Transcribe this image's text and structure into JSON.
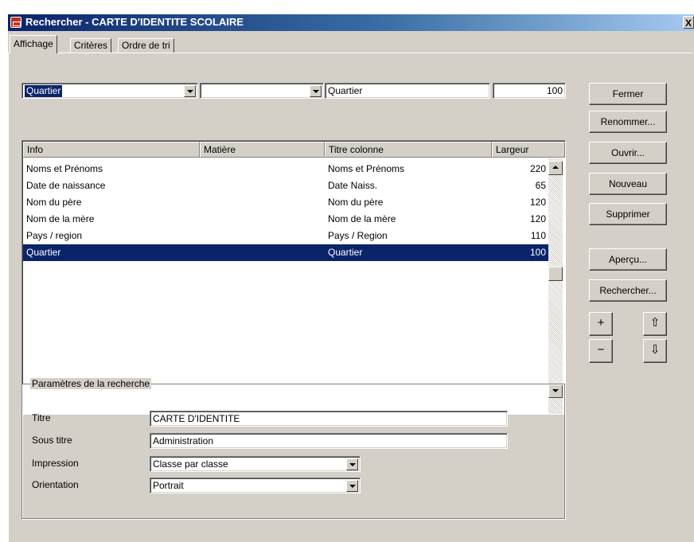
{
  "window": {
    "title": "Rechercher - CARTE D'IDENTITE SCOLAIRE",
    "close_label": "X"
  },
  "tabs": [
    {
      "label": "Affichage",
      "active": true
    },
    {
      "label": "Critères",
      "active": false
    },
    {
      "label": "Ordre de tri",
      "active": false
    }
  ],
  "editor": {
    "info_select": "Quartier",
    "matiere_select": "",
    "titre_colonne": "Quartier",
    "largeur": "100"
  },
  "grid": {
    "columns": [
      "Info",
      "Matière",
      "Titre colonne",
      "Largeur"
    ],
    "rows": [
      {
        "info": "Noms et Prénoms",
        "matiere": "",
        "titre": "Noms et Prénoms",
        "largeur": "220"
      },
      {
        "info": "Date de naissance",
        "matiere": "",
        "titre": "Date Naiss.",
        "largeur": "65"
      },
      {
        "info": "Nom du père",
        "matiere": "",
        "titre": "Nom du père",
        "largeur": "120"
      },
      {
        "info": "Nom de la mère",
        "matiere": "",
        "titre": "Nom de la mère",
        "largeur": "120"
      },
      {
        "info": "Pays / region",
        "matiere": "",
        "titre": "Pays / Region",
        "largeur": "110"
      },
      {
        "info": "Quartier",
        "matiere": "",
        "titre": "Quartier",
        "largeur": "100",
        "selected": true
      }
    ]
  },
  "buttons": {
    "fermer": "Fermer",
    "renommer": "Renommer...",
    "ouvrir": "Ouvrir...",
    "nouveau": "Nouveau",
    "supprimer": "Supprimer",
    "apercu": "Aperçu...",
    "rechercher": "Rechercher...",
    "plus": "+",
    "minus": "−",
    "up": "⇧",
    "down": "⇩"
  },
  "params": {
    "legend": "Paramètres de la recherche",
    "titre_label": "Titre",
    "titre_value": "CARTE D'IDENTITE",
    "sous_titre_label": "Sous titre",
    "sous_titre_value": "Administration",
    "impression_label": "Impression",
    "impression_value": "Classe par classe",
    "orientation_label": "Orientation",
    "orientation_value": "Portrait"
  },
  "colors": {
    "face": "#d4d0c8",
    "selection": "#0a246a",
    "title_gradient_start": "#0a246a",
    "title_gradient_end": "#a6caf0"
  }
}
